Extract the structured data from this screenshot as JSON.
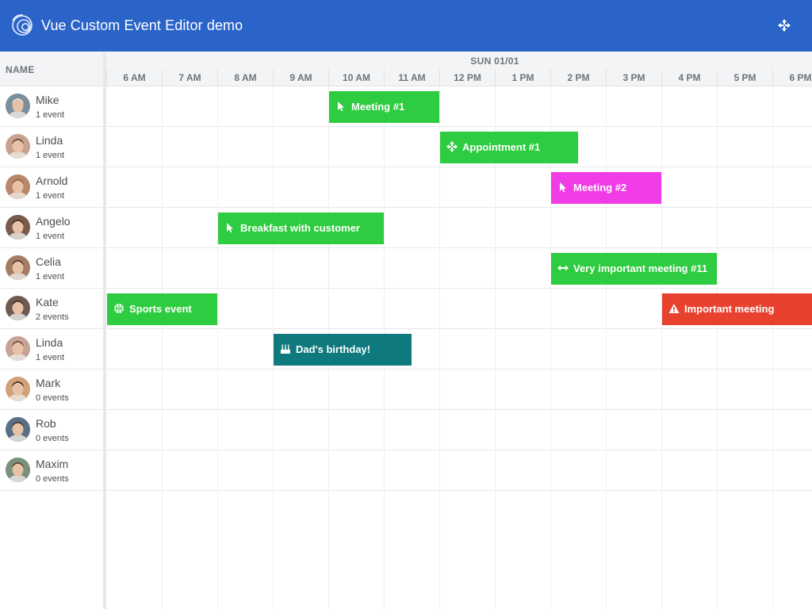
{
  "header": {
    "title": "Vue Custom Event Editor demo"
  },
  "grid": {
    "name_column_label": "NAME",
    "date_label": "SUN 01/01"
  },
  "hours": [
    "6 AM",
    "7 AM",
    "8 AM",
    "9 AM",
    "10 AM",
    "11 AM",
    "12 PM",
    "1 PM",
    "2 PM",
    "3 PM",
    "4 PM",
    "5 PM",
    "6 PM"
  ],
  "resources": [
    {
      "name": "Mike",
      "count": "1 event"
    },
    {
      "name": "Linda",
      "count": "1 event"
    },
    {
      "name": "Arnold",
      "count": "1 event"
    },
    {
      "name": "Angelo",
      "count": "1 event"
    },
    {
      "name": "Celia",
      "count": "1 event"
    },
    {
      "name": "Kate",
      "count": "2 events"
    },
    {
      "name": "Linda",
      "count": "1 event"
    },
    {
      "name": "Mark",
      "count": "0 events"
    },
    {
      "name": "Rob",
      "count": "0 events"
    },
    {
      "name": "Maxim",
      "count": "0 events"
    }
  ],
  "events": [
    {
      "name": "Meeting #1",
      "icon": "pointer-icon",
      "color": "#2ecc40",
      "start": "10:00",
      "end": "12:00",
      "resource": 0
    },
    {
      "name": "Appointment #1",
      "icon": "move-icon",
      "color": "#2ecc40",
      "start": "12:00",
      "end": "14:30",
      "resource": 1
    },
    {
      "name": "Meeting #2",
      "icon": "pointer-icon",
      "color": "#f03ce6",
      "start": "14:00",
      "end": "16:00",
      "resource": 2
    },
    {
      "name": "Breakfast with customer",
      "icon": "pointer-icon",
      "color": "#2ecc40",
      "start": "08:00",
      "end": "11:00",
      "resource": 3
    },
    {
      "name": "Very important meeting #11",
      "icon": "resize-arrows-icon",
      "color": "#2ecc40",
      "start": "14:00",
      "end": "17:00",
      "resource": 4
    },
    {
      "name": "Sports event",
      "icon": "basketball-icon",
      "color": "#2ecc40",
      "start": "06:00",
      "end": "08:00",
      "resource": 5
    },
    {
      "name": "Important meeting",
      "icon": "warning-icon",
      "color": "#e8412e",
      "start": "16:00",
      "end": "19:00",
      "resource": 5
    },
    {
      "name": "Dad's birthday!",
      "icon": "birthday-cake-icon",
      "color": "#0f7a7e",
      "start": "09:00",
      "end": "11:30",
      "resource": 6
    }
  ]
}
